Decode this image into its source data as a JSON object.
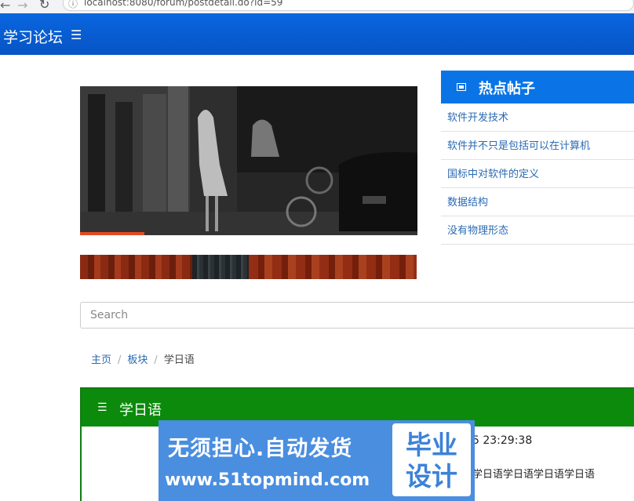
{
  "browser": {
    "url": "localhost:8080/forum/postdetail.do?id=59"
  },
  "header": {
    "brand": "学习论坛"
  },
  "search": {
    "placeholder": "Search"
  },
  "breadcrumb": {
    "home": "主页",
    "section": "板块",
    "current": "学日语"
  },
  "hot_posts": {
    "title": "热点帖子",
    "items": [
      {
        "label": "软件开发技术"
      },
      {
        "label": "软件并不只是包括可以在计算机"
      },
      {
        "label": "国标中对软件的定义"
      },
      {
        "label": "数据结构"
      },
      {
        "label": "没有物理形态"
      }
    ]
  },
  "board": {
    "title": "学日语",
    "post_time_partial": "5 23:29:38",
    "post_content_partial": "学日语学日语学日语学日语"
  },
  "watermark": {
    "slogan": "无须担心.自动发货",
    "url": "www.51topmind.com",
    "badge": "毕业设计"
  },
  "carousel": {
    "progress": 0.19
  }
}
